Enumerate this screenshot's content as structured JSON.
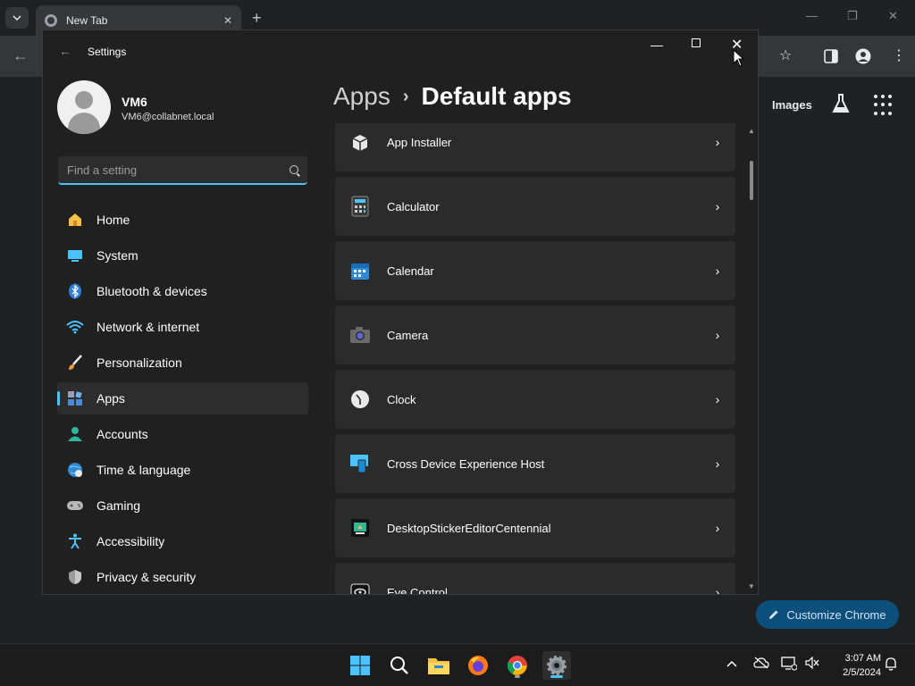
{
  "chrome": {
    "tab_title": "New Tab",
    "new_tab": "+",
    "images_link": "Images",
    "customize_label": "Customize Chrome"
  },
  "settings": {
    "window_title": "Settings",
    "profile": {
      "name": "VM6",
      "email": "VM6@collabnet.local"
    },
    "search": {
      "placeholder": "Find a setting"
    },
    "nav": [
      {
        "label": "Home",
        "icon": "home-icon"
      },
      {
        "label": "System",
        "icon": "system-icon"
      },
      {
        "label": "Bluetooth & devices",
        "icon": "bluetooth-icon"
      },
      {
        "label": "Network & internet",
        "icon": "wifi-icon"
      },
      {
        "label": "Personalization",
        "icon": "brush-icon"
      },
      {
        "label": "Apps",
        "icon": "apps-icon",
        "active": true
      },
      {
        "label": "Accounts",
        "icon": "accounts-icon"
      },
      {
        "label": "Time & language",
        "icon": "globe-icon"
      },
      {
        "label": "Gaming",
        "icon": "gamepad-icon"
      },
      {
        "label": "Accessibility",
        "icon": "accessibility-icon"
      },
      {
        "label": "Privacy & security",
        "icon": "shield-icon"
      }
    ],
    "breadcrumb": {
      "parent": "Apps",
      "separator": "›",
      "current": "Default apps"
    },
    "apps": [
      {
        "name": "App Installer",
        "icon": "app-installer-icon"
      },
      {
        "name": "Calculator",
        "icon": "calculator-icon"
      },
      {
        "name": "Calendar",
        "icon": "calendar-icon"
      },
      {
        "name": "Camera",
        "icon": "camera-icon"
      },
      {
        "name": "Clock",
        "icon": "clock-icon"
      },
      {
        "name": "Cross Device Experience Host",
        "icon": "cross-device-icon"
      },
      {
        "name": "DesktopStickerEditorCentennial",
        "icon": "sticker-editor-icon"
      },
      {
        "name": "Eye Control",
        "icon": "eye-control-icon"
      }
    ]
  },
  "taskbar": {
    "time": "3:07 AM",
    "date": "2/5/2024"
  },
  "colors": {
    "accent": "#4cc2ff",
    "settings_bg": "#202020",
    "row_bg": "#2b2b2b",
    "chrome_bg": "#202124"
  }
}
